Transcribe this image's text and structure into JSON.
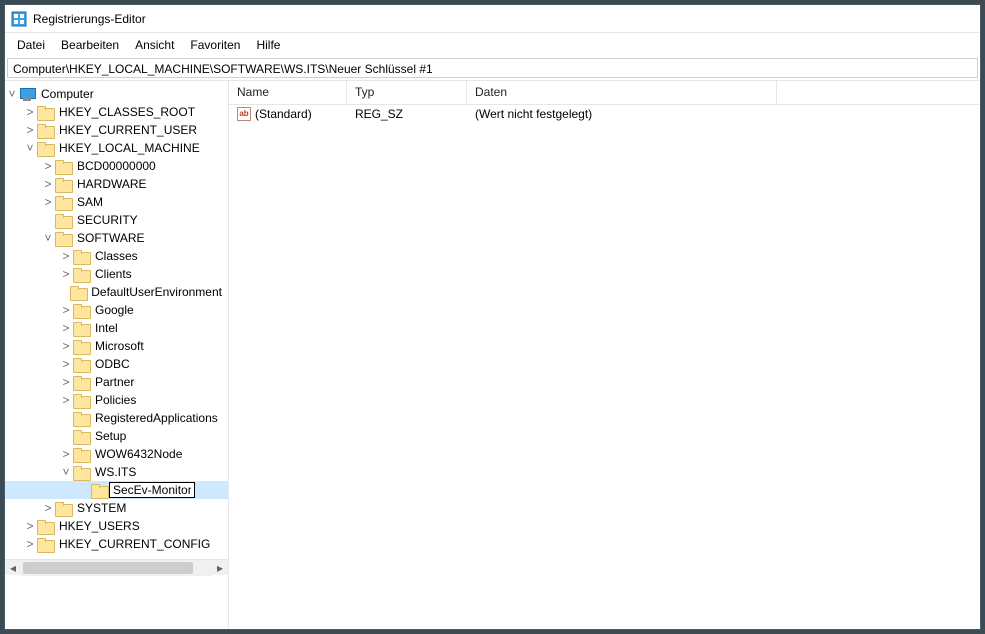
{
  "window": {
    "title": "Registrierungs-Editor"
  },
  "menus": [
    "Datei",
    "Bearbeiten",
    "Ansicht",
    "Favoriten",
    "Hilfe"
  ],
  "address": "Computer\\HKEY_LOCAL_MACHINE\\SOFTWARE\\WS.ITS\\Neuer Schlüssel #1",
  "tree": [
    {
      "depth": 0,
      "label": "Computer",
      "expandable": true,
      "expanded": true,
      "icon": "pc",
      "name": "tree-computer"
    },
    {
      "depth": 1,
      "label": "HKEY_CLASSES_ROOT",
      "expandable": true,
      "expanded": false,
      "name": "tree-hkcr"
    },
    {
      "depth": 1,
      "label": "HKEY_CURRENT_USER",
      "expandable": true,
      "expanded": false,
      "name": "tree-hkcu"
    },
    {
      "depth": 1,
      "label": "HKEY_LOCAL_MACHINE",
      "expandable": true,
      "expanded": true,
      "name": "tree-hklm"
    },
    {
      "depth": 2,
      "label": "BCD00000000",
      "expandable": true,
      "expanded": false,
      "name": "tree-bcd"
    },
    {
      "depth": 2,
      "label": "HARDWARE",
      "expandable": true,
      "expanded": false,
      "name": "tree-hardware"
    },
    {
      "depth": 2,
      "label": "SAM",
      "expandable": true,
      "expanded": false,
      "name": "tree-sam"
    },
    {
      "depth": 2,
      "label": "SECURITY",
      "expandable": false,
      "expanded": false,
      "name": "tree-security"
    },
    {
      "depth": 2,
      "label": "SOFTWARE",
      "expandable": true,
      "expanded": true,
      "name": "tree-software"
    },
    {
      "depth": 3,
      "label": "Classes",
      "expandable": true,
      "expanded": false,
      "name": "tree-classes"
    },
    {
      "depth": 3,
      "label": "Clients",
      "expandable": true,
      "expanded": false,
      "name": "tree-clients"
    },
    {
      "depth": 3,
      "label": "DefaultUserEnvironment",
      "expandable": false,
      "expanded": false,
      "name": "tree-due"
    },
    {
      "depth": 3,
      "label": "Google",
      "expandable": true,
      "expanded": false,
      "name": "tree-google"
    },
    {
      "depth": 3,
      "label": "Intel",
      "expandable": true,
      "expanded": false,
      "name": "tree-intel"
    },
    {
      "depth": 3,
      "label": "Microsoft",
      "expandable": true,
      "expanded": false,
      "name": "tree-microsoft"
    },
    {
      "depth": 3,
      "label": "ODBC",
      "expandable": true,
      "expanded": false,
      "name": "tree-odbc"
    },
    {
      "depth": 3,
      "label": "Partner",
      "expandable": true,
      "expanded": false,
      "name": "tree-partner"
    },
    {
      "depth": 3,
      "label": "Policies",
      "expandable": true,
      "expanded": false,
      "name": "tree-policies"
    },
    {
      "depth": 3,
      "label": "RegisteredApplications",
      "expandable": false,
      "expanded": false,
      "name": "tree-regapps"
    },
    {
      "depth": 3,
      "label": "Setup",
      "expandable": false,
      "expanded": false,
      "name": "tree-setup"
    },
    {
      "depth": 3,
      "label": "WOW6432Node",
      "expandable": true,
      "expanded": false,
      "name": "tree-wow64"
    },
    {
      "depth": 3,
      "label": "WS.ITS",
      "expandable": true,
      "expanded": true,
      "name": "tree-wsits"
    },
    {
      "depth": 4,
      "label": "SecEv-Monitor",
      "expandable": false,
      "expanded": false,
      "editing": true,
      "selected": true,
      "name": "tree-wsits-new"
    },
    {
      "depth": 2,
      "label": "SYSTEM",
      "expandable": true,
      "expanded": false,
      "name": "tree-system"
    },
    {
      "depth": 1,
      "label": "HKEY_USERS",
      "expandable": true,
      "expanded": false,
      "name": "tree-hku"
    },
    {
      "depth": 1,
      "label": "HKEY_CURRENT_CONFIG",
      "expandable": true,
      "expanded": false,
      "name": "tree-hkcc"
    }
  ],
  "list": {
    "columns": {
      "name": "Name",
      "type": "Typ",
      "data": "Daten"
    },
    "rows": [
      {
        "name": "(Standard)",
        "type": "REG_SZ",
        "data": "(Wert nicht festgelegt)",
        "icon": "ab"
      }
    ]
  }
}
